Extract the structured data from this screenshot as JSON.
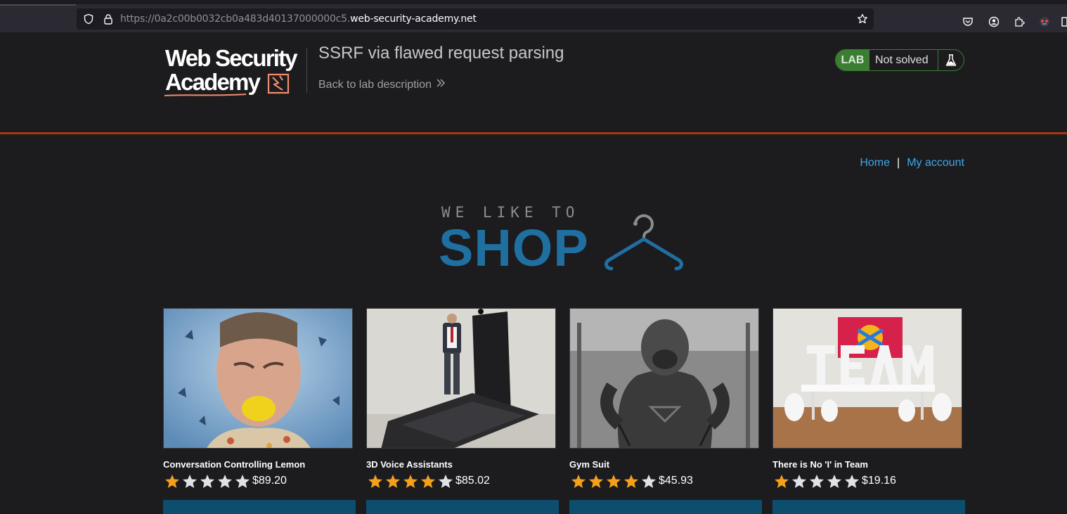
{
  "browser": {
    "url_prefix": "https://0a2c00b0032cb0a483d40137000000c5.",
    "url_domain": "web-security-academy.net",
    "toolbar_icons": [
      "shield-icon",
      "lock-icon",
      "star-icon",
      "pocket-icon",
      "account-icon",
      "extensions-icon",
      "profile-icon"
    ]
  },
  "header": {
    "logo_line1": "Web Security",
    "logo_line2": "Academy",
    "lab_title": "SSRF via flawed request parsing",
    "back_link": "Back to lab description",
    "lab_badge": "LAB",
    "lab_status": "Not solved",
    "accent_color": "#ab3513"
  },
  "nav": {
    "home": "Home",
    "separator": "|",
    "my_account": "My account"
  },
  "banner": {
    "top_text": "WE LIKE TO",
    "shop_text": "SHOP"
  },
  "products": [
    {
      "name": "Conversation Controlling Lemon",
      "price": "$89.20",
      "rating": 1,
      "max_rating": 5
    },
    {
      "name": "3D Voice Assistants",
      "price": "$85.02",
      "rating": 4,
      "max_rating": 5
    },
    {
      "name": "Gym Suit",
      "price": "$45.93",
      "rating": 4,
      "max_rating": 5
    },
    {
      "name": "There is No 'I' in Team",
      "price": "$19.16",
      "rating": 1,
      "max_rating": 5
    }
  ]
}
